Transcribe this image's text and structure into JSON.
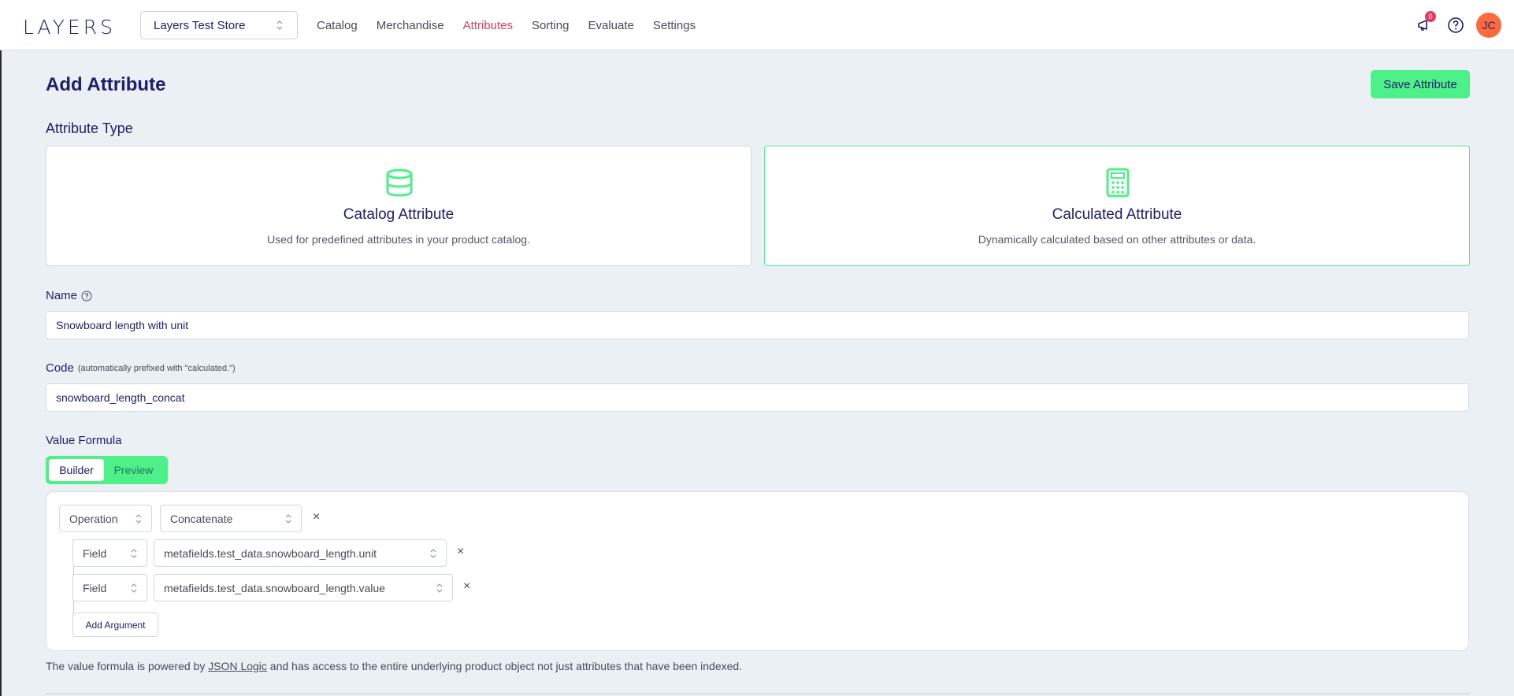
{
  "header": {
    "logo": "LAYERS",
    "store": "Layers Test Store",
    "nav": [
      "Catalog",
      "Merchandise",
      "Attributes",
      "Sorting",
      "Evaluate",
      "Settings"
    ],
    "active_nav": "Attributes",
    "notification_count": "0",
    "avatar_initials": "JC"
  },
  "page": {
    "title": "Add Attribute",
    "save_label": "Save Attribute",
    "attribute_type_label": "Attribute Type"
  },
  "types": [
    {
      "title": "Catalog Attribute",
      "desc": "Used for predefined attributes in your product catalog.",
      "icon": "database-icon",
      "selected": false
    },
    {
      "title": "Calculated Attribute",
      "desc": "Dynamically calculated based on other attributes or data.",
      "icon": "calculator-icon",
      "selected": true
    }
  ],
  "form": {
    "name_label": "Name",
    "name_value": "Snowboard length with unit",
    "code_label": "Code",
    "code_hint": "(automatically prefixed with \"calculated.\")",
    "code_value": "snowboard_length_concat",
    "formula_label": "Value Formula",
    "tabs": [
      "Builder",
      "Preview"
    ],
    "active_tab": "Builder"
  },
  "builder": {
    "op_type": "Operation",
    "op_value": "Concatenate",
    "args": [
      {
        "type": "Field",
        "value": "metafields.test_data.snowboard_length.unit"
      },
      {
        "type": "Field",
        "value": "metafields.test_data.snowboard_length.value"
      }
    ],
    "add_argument_label": "Add Argument",
    "remove_symbol": "×"
  },
  "footnote": {
    "before": "The value formula is powered by ",
    "link": "JSON Logic",
    "after": " and has access to the entire underlying product object not just attributes that have been indexed."
  },
  "colors": {
    "accent": "#4ef08a",
    "active_nav": "#e83a5f",
    "text": "#1e1e6e",
    "background": "#eaf0f4",
    "avatar": "#ff6a3d"
  }
}
